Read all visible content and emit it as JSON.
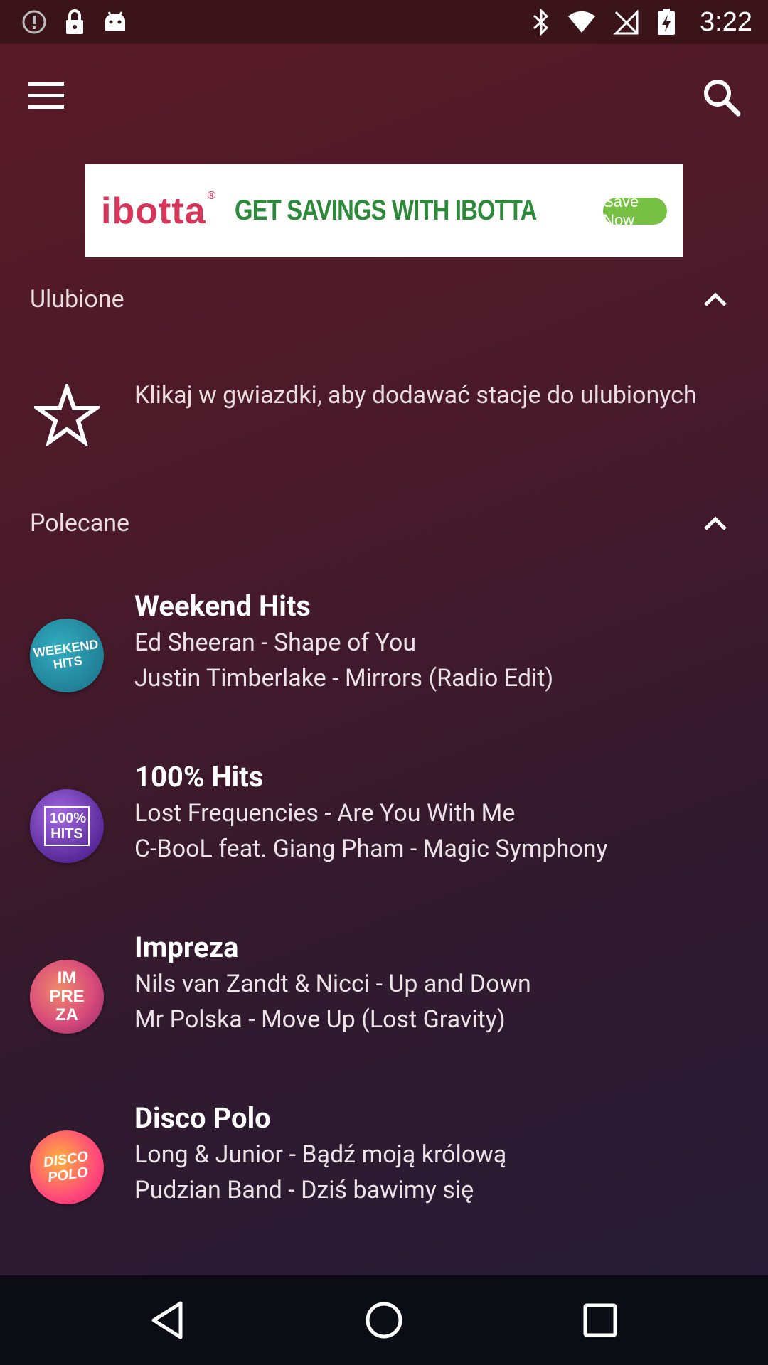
{
  "status_bar": {
    "time": "3:22",
    "left_icons": [
      "alert-circle-icon",
      "lock-icon",
      "android-icon"
    ],
    "right_icons": [
      "bluetooth-icon",
      "wifi-icon",
      "no-signal-icon",
      "battery-charging-icon"
    ]
  },
  "app_bar": {
    "menu_icon": "menu-icon",
    "search_icon": "search-icon"
  },
  "ad": {
    "brand": "ibotta",
    "brand_mark": "®",
    "headline": "GET SAVINGS WITH IBOTTA",
    "cta": "Save Now",
    "colors": {
      "brand": "#d6365a",
      "headline": "#2d8a3a",
      "cta_bg": "#76c043"
    }
  },
  "favorites": {
    "title": "Ulubione",
    "hint": "Klikaj w gwiazdki, aby dodawać stacje do ulubionych"
  },
  "recommended": {
    "title": "Polecane",
    "stations": [
      {
        "name": "Weekend Hits",
        "logo_text": "WEEKEND HITS",
        "line1": "Ed Sheeran - Shape of You",
        "line2": "Justin Timberlake - Mirrors (Radio Edit)"
      },
      {
        "name": "100% Hits",
        "logo_text": "100% HITS",
        "line1": "Lost Frequencies - Are You With Me",
        "line2": "C-BooL feat. Giang Pham - Magic Symphony"
      },
      {
        "name": "Impreza",
        "logo_text": "IM PRE ZA",
        "line1": "Nils van Zandt & Nicci - Up and Down",
        "line2": "Mr Polska - Move Up (Lost Gravity)"
      },
      {
        "name": "Disco Polo",
        "logo_text": "DISCO POLO",
        "line1": "Long & Junior - Bądź moją królową",
        "line2": "Pudzian Band - Dziś bawimy się"
      }
    ]
  },
  "nav_bar": {
    "back_icon": "back-triangle-icon",
    "home_icon": "home-circle-icon",
    "recent_icon": "recent-apps-square-icon"
  }
}
